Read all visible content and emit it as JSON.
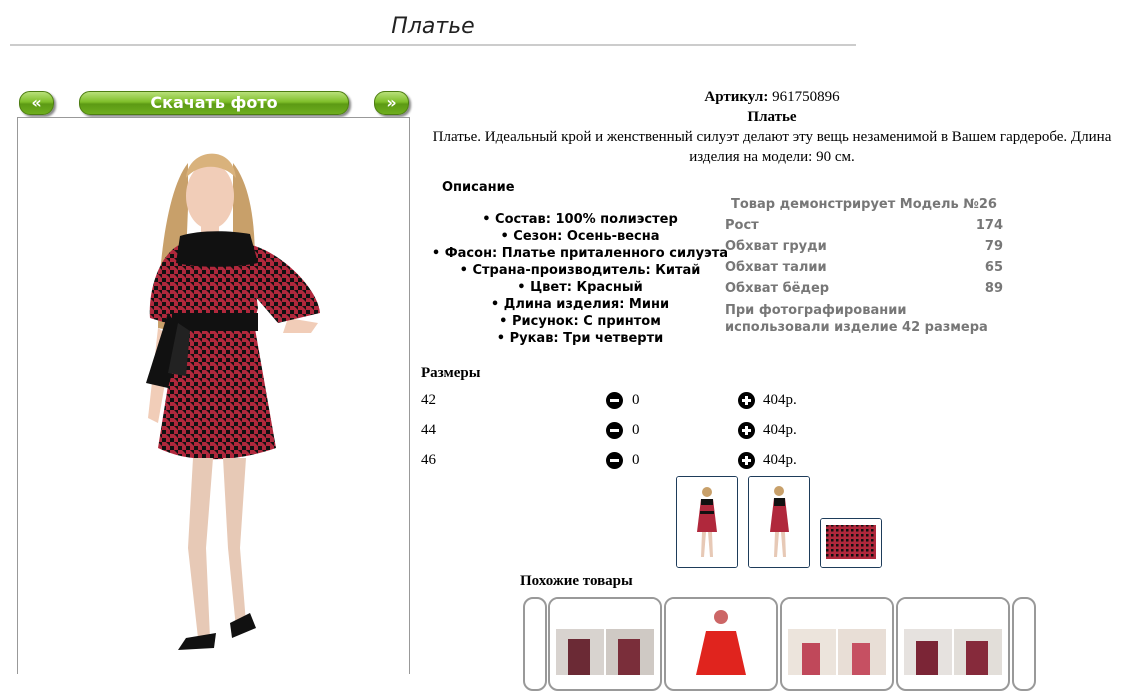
{
  "page": {
    "title": "Платье"
  },
  "gallery": {
    "prev_label": "«",
    "download_label": "Скачать фото",
    "next_label": "»"
  },
  "product": {
    "sku_label": "Артикул:",
    "sku": "961750896",
    "name": "Платье",
    "description": "Платье. Идеальный крой и женственный силуэт делают эту вещь незаменимой в Вашем гардеробе. Длина изделия на модели: 90 см."
  },
  "details": {
    "title": "Описание",
    "items": [
      "Состав: 100% полиэстер",
      "Сезон: Осень-весна",
      "Фасон: Платье приталенного силуэта",
      "Страна-производитель: Китай",
      "Цвет: Красный",
      "Длина изделия: Мини",
      "Рисунок: С принтом",
      "Рукав: Три четверти"
    ]
  },
  "model": {
    "title": "Товар демонстрирует Модель №26",
    "rows": [
      {
        "label": "Рост",
        "value": "174"
      },
      {
        "label": "Обхват груди",
        "value": "79"
      },
      {
        "label": "Обхват талии",
        "value": "65"
      },
      {
        "label": "Обхват бёдер",
        "value": "89"
      }
    ],
    "note": "При фотографировании использовали изделие 42 размера"
  },
  "sizes": {
    "title": "Размеры",
    "rows": [
      {
        "size": "42",
        "qty": "0",
        "price": "404р."
      },
      {
        "size": "44",
        "qty": "0",
        "price": "404р."
      },
      {
        "size": "46",
        "qty": "0",
        "price": "404р."
      }
    ]
  },
  "similar": {
    "title": "Похожие товары"
  },
  "colors": {
    "dress_red": "#b0283c",
    "dress_black": "#111111",
    "button_green": "#6fae1e",
    "thumb_border": "#1e3c5a"
  },
  "icons": [
    "minus-circle-icon",
    "plus-circle-icon"
  ]
}
